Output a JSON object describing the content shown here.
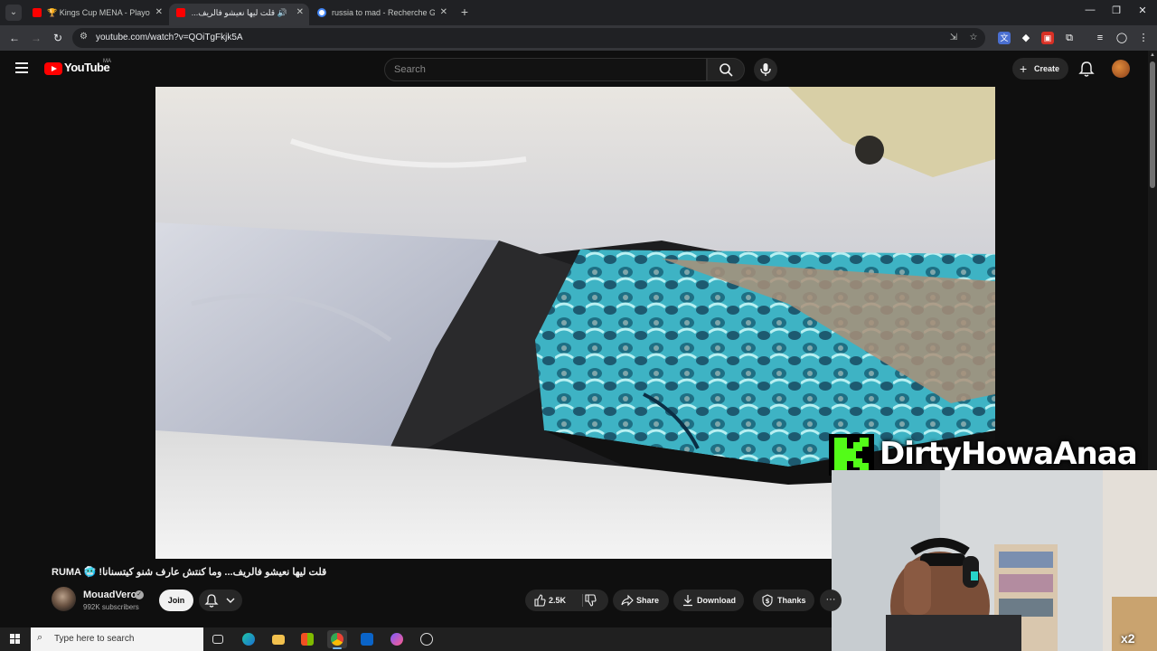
{
  "browser": {
    "tabs": [
      {
        "title": "🏆 Kings Cup MENA - Playoff",
        "favicon": "youtube-icon",
        "active": false
      },
      {
        "title": "قلت ليها نعيشو فالريف... وما",
        "favicon": "youtube-icon",
        "active": true,
        "audio": true
      },
      {
        "title": "russia to mad - Recherche Goo",
        "favicon": "google-icon",
        "active": false
      }
    ],
    "new_tab_symbol": "+",
    "window_controls": {
      "minimize": "—",
      "restore": "❐",
      "close": "✕"
    },
    "url": "youtube.com/watch?v=QOiTgFkjk5A"
  },
  "youtube": {
    "logo_text": "YouTube",
    "region": "MA",
    "search_placeholder": "Search",
    "create_label": "Create",
    "colors": {
      "brand_red": "#ff0000",
      "background": "#0f0f0f",
      "pill": "#272727"
    }
  },
  "video": {
    "title": "RUMA 🥶 !قلت ليها نعيشو فالريف... وما كنتش عارف شنو كيتسنانا",
    "channel": "MouadVero",
    "subscribers": "992K subscribers",
    "join_label": "Join",
    "likes": "2.5K",
    "share_label": "Share",
    "download_label": "Download",
    "thanks_label": "Thanks",
    "more_label": "···"
  },
  "overlay": {
    "streamer_name": "DirtyHowaAnaa",
    "platform_letter": "K",
    "platform_color": "#53fc18",
    "speed_badge": "x2"
  },
  "taskbar": {
    "search_placeholder": "Type here to search",
    "apps": [
      "task-view-icon",
      "edge-icon",
      "file-explorer-icon",
      "store-icon",
      "chrome-icon",
      "outlook-icon",
      "messenger-icon",
      "obs-icon"
    ]
  }
}
